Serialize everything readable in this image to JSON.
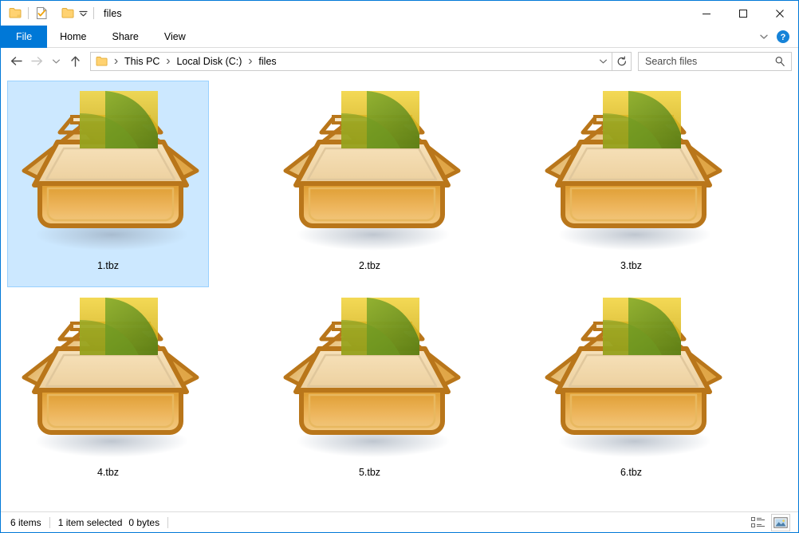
{
  "window": {
    "title": "files",
    "accent_color": "#0078d7",
    "selection_color": "#cce8ff",
    "quick_access": [
      {
        "name": "folder",
        "icon": "folder-icon",
        "label": "Folder"
      },
      {
        "name": "properties",
        "icon": "properties-icon",
        "label": "Properties"
      },
      {
        "name": "new-folder",
        "icon": "new-folder-icon",
        "label": "New folder"
      }
    ],
    "controls": {
      "minimize": "─",
      "maximize": "☐",
      "close": "✕"
    }
  },
  "ribbon": {
    "tabs": [
      {
        "label": "File",
        "active": true
      },
      {
        "label": "Home",
        "active": false
      },
      {
        "label": "Share",
        "active": false
      },
      {
        "label": "View",
        "active": false
      }
    ],
    "expand_icon": "chevron-down-icon",
    "help_label": "?"
  },
  "navigation": {
    "back": "←",
    "forward": "→",
    "recent": "˅",
    "up": "↑"
  },
  "breadcrumb": {
    "folder_icon": "folder-icon",
    "separator": "›",
    "items": [
      {
        "label": "This PC"
      },
      {
        "label": "Local Disk (C:)"
      },
      {
        "label": "files"
      }
    ],
    "dropdown_icon": "chevron-down-icon",
    "refresh_icon": "refresh-icon"
  },
  "search": {
    "placeholder": "Search files",
    "value": "",
    "icon": "search-icon"
  },
  "files": {
    "items": [
      {
        "name": "1.tbz",
        "type": "archive",
        "selected": true
      },
      {
        "name": "2.tbz",
        "type": "archive",
        "selected": false
      },
      {
        "name": "3.tbz",
        "type": "archive",
        "selected": false
      },
      {
        "name": "4.tbz",
        "type": "archive",
        "selected": false
      },
      {
        "name": "5.tbz",
        "type": "archive",
        "selected": false
      },
      {
        "name": "6.tbz",
        "type": "archive",
        "selected": false
      }
    ]
  },
  "status": {
    "item_count": "6 items",
    "selection": "1 item selected",
    "size": "0 bytes",
    "view_buttons": [
      {
        "name": "details-view",
        "icon": "details-view-icon",
        "active": false
      },
      {
        "name": "large-icons-view",
        "icon": "large-icons-view-icon",
        "active": true
      }
    ]
  }
}
